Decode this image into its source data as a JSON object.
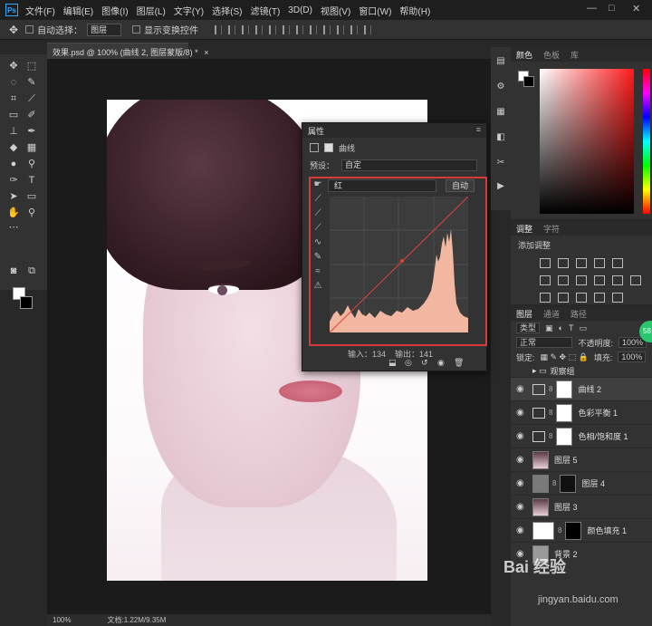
{
  "menubar": {
    "logo": "Ps",
    "items": [
      "文件(F)",
      "编辑(E)",
      "图像(I)",
      "图层(L)",
      "文字(Y)",
      "选择(S)",
      "滤镜(T)",
      "3D(D)",
      "视图(V)",
      "窗口(W)",
      "帮助(H)"
    ],
    "minimize": "—",
    "maximize": "□",
    "close": "✕"
  },
  "options": {
    "auto_select": "自动选择：",
    "layer_select": "图层",
    "show_transform": "显示变换控件"
  },
  "document": {
    "tab": "效果.psd @ 100% (曲线 2, 图层蒙版/8) *",
    "tab_close": "×",
    "zoom": "100%",
    "doc_size": "文档:1.22M/9.35M"
  },
  "properties": {
    "title": "属性",
    "close": "≡",
    "panel_label": "曲线",
    "preset_label": "预设：",
    "preset_value": "自定",
    "channel": "红",
    "auto": "自动",
    "input_label": "输入：134",
    "output_label": "输出：141"
  },
  "color_panel": {
    "tabs": [
      "颜色",
      "色板",
      "库"
    ],
    "accent": "#ff1a1a"
  },
  "adjustments": {
    "tabs": [
      "调整",
      "字符"
    ],
    "add_label": "添加调整"
  },
  "layers_panel": {
    "tabs": [
      "图层",
      "通道",
      "路径"
    ],
    "filter": "类型",
    "blend_mode": "正常",
    "opacity_label": "不透明度:",
    "opacity": "100%",
    "lock_label": "锁定:",
    "fill_label": "填充:",
    "fill": "100%",
    "group_name": "观察组",
    "layers": [
      {
        "name": "曲线 2",
        "active": true
      },
      {
        "name": "色彩平衡 1",
        "active": false
      },
      {
        "name": "色相/饱和度 1",
        "active": false
      },
      {
        "name": "图层 5",
        "active": false
      },
      {
        "name": "图层 4",
        "active": false
      },
      {
        "name": "图层 3",
        "active": false
      },
      {
        "name": "颜色填充 1",
        "active": false
      },
      {
        "name": "背景 2",
        "active": false
      }
    ]
  },
  "watermark": {
    "brand": "Bai 经验",
    "url": "jingyan.baidu.com"
  },
  "badge": "58"
}
